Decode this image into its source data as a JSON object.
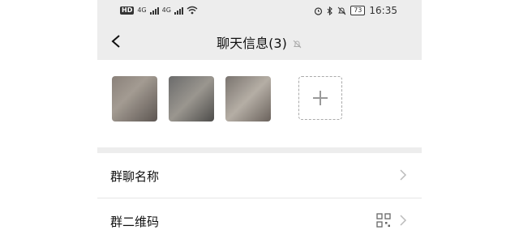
{
  "status_bar": {
    "network_badge": "HD",
    "sim1": "4G",
    "sim2": "4G",
    "battery": "73",
    "time": "16:35"
  },
  "header": {
    "title": "聊天信息(3)",
    "icons": [
      "chevron-left-icon",
      "bell-muted-icon"
    ]
  },
  "members": {
    "avatars": [
      "member-avatar-1",
      "member-avatar-2",
      "member-avatar-3"
    ],
    "add_icon": "plus-icon"
  },
  "settings": {
    "group_name_label": "群聊名称",
    "group_qr_label": "群二维码"
  }
}
